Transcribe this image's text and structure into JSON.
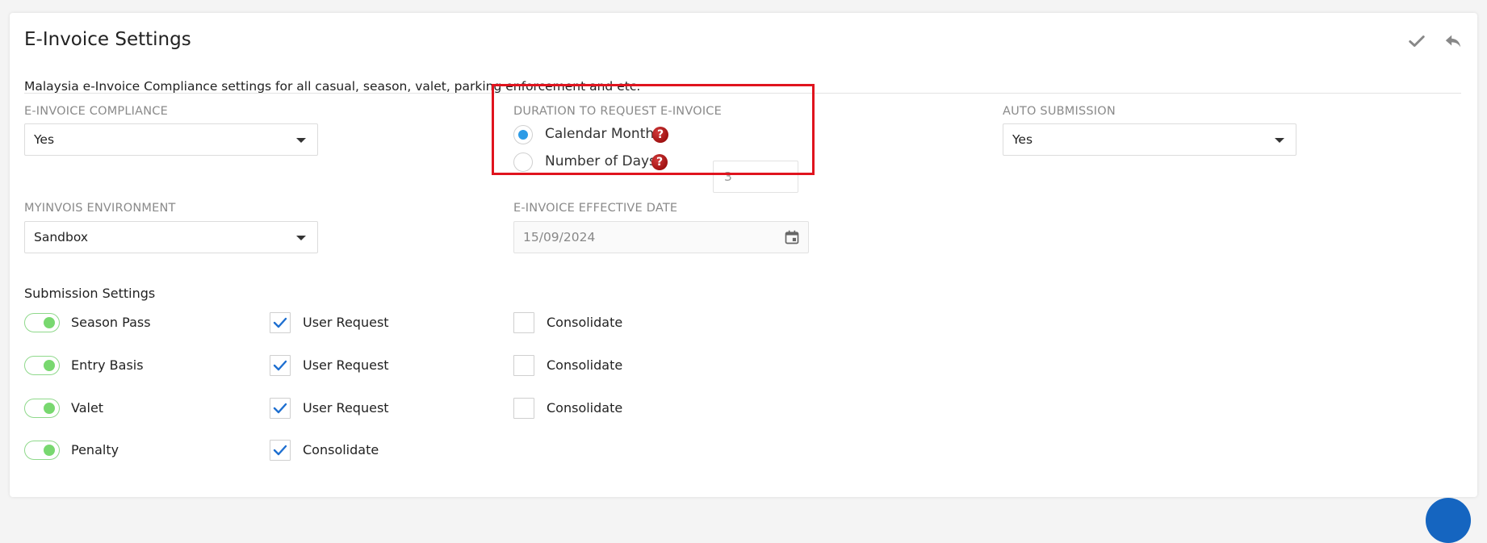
{
  "page": {
    "title": "E-Invoice Settings",
    "description": "Malaysia e-Invoice Compliance settings for all casual, season, valet, parking enforcement and etc."
  },
  "fields": {
    "compliance": {
      "label": "E-INVOICE COMPLIANCE",
      "value": "Yes"
    },
    "duration": {
      "label": "DURATION TO REQUEST E-INVOICE",
      "option_calendar": "Calendar Month",
      "option_days": "Number of Days",
      "days_value": "3",
      "selected": "calendar_month"
    },
    "auto_submission": {
      "label": "AUTO SUBMISSION",
      "value": "Yes"
    },
    "environment": {
      "label": "MYINVOIS ENVIRONMENT",
      "value": "Sandbox"
    },
    "effective_date": {
      "label": "E-INVOICE EFFECTIVE DATE",
      "value": "15/09/2024"
    }
  },
  "submission": {
    "heading": "Submission Settings",
    "rows": [
      {
        "label": "Season Pass",
        "enabled": true,
        "option1": "User Request",
        "option1_checked": true,
        "option2": "Consolidate",
        "option2_checked": false
      },
      {
        "label": "Entry Basis",
        "enabled": true,
        "option1": "User Request",
        "option1_checked": true,
        "option2": "Consolidate",
        "option2_checked": false
      },
      {
        "label": "Valet",
        "enabled": true,
        "option1": "User Request",
        "option1_checked": true,
        "option2": "Consolidate",
        "option2_checked": false
      },
      {
        "label": "Penalty",
        "enabled": true,
        "option1": "Consolidate",
        "option1_checked": true
      }
    ]
  },
  "icons": {
    "save": "check-icon",
    "back": "reply-icon",
    "help": "question-icon",
    "calendar": "calendar-icon"
  },
  "colors": {
    "highlight": "#e0141e",
    "radio_selected": "#2d9be6",
    "toggle_on": "#78d86f",
    "checkmark": "#1e6fd0",
    "help_icon": "#b00000"
  }
}
